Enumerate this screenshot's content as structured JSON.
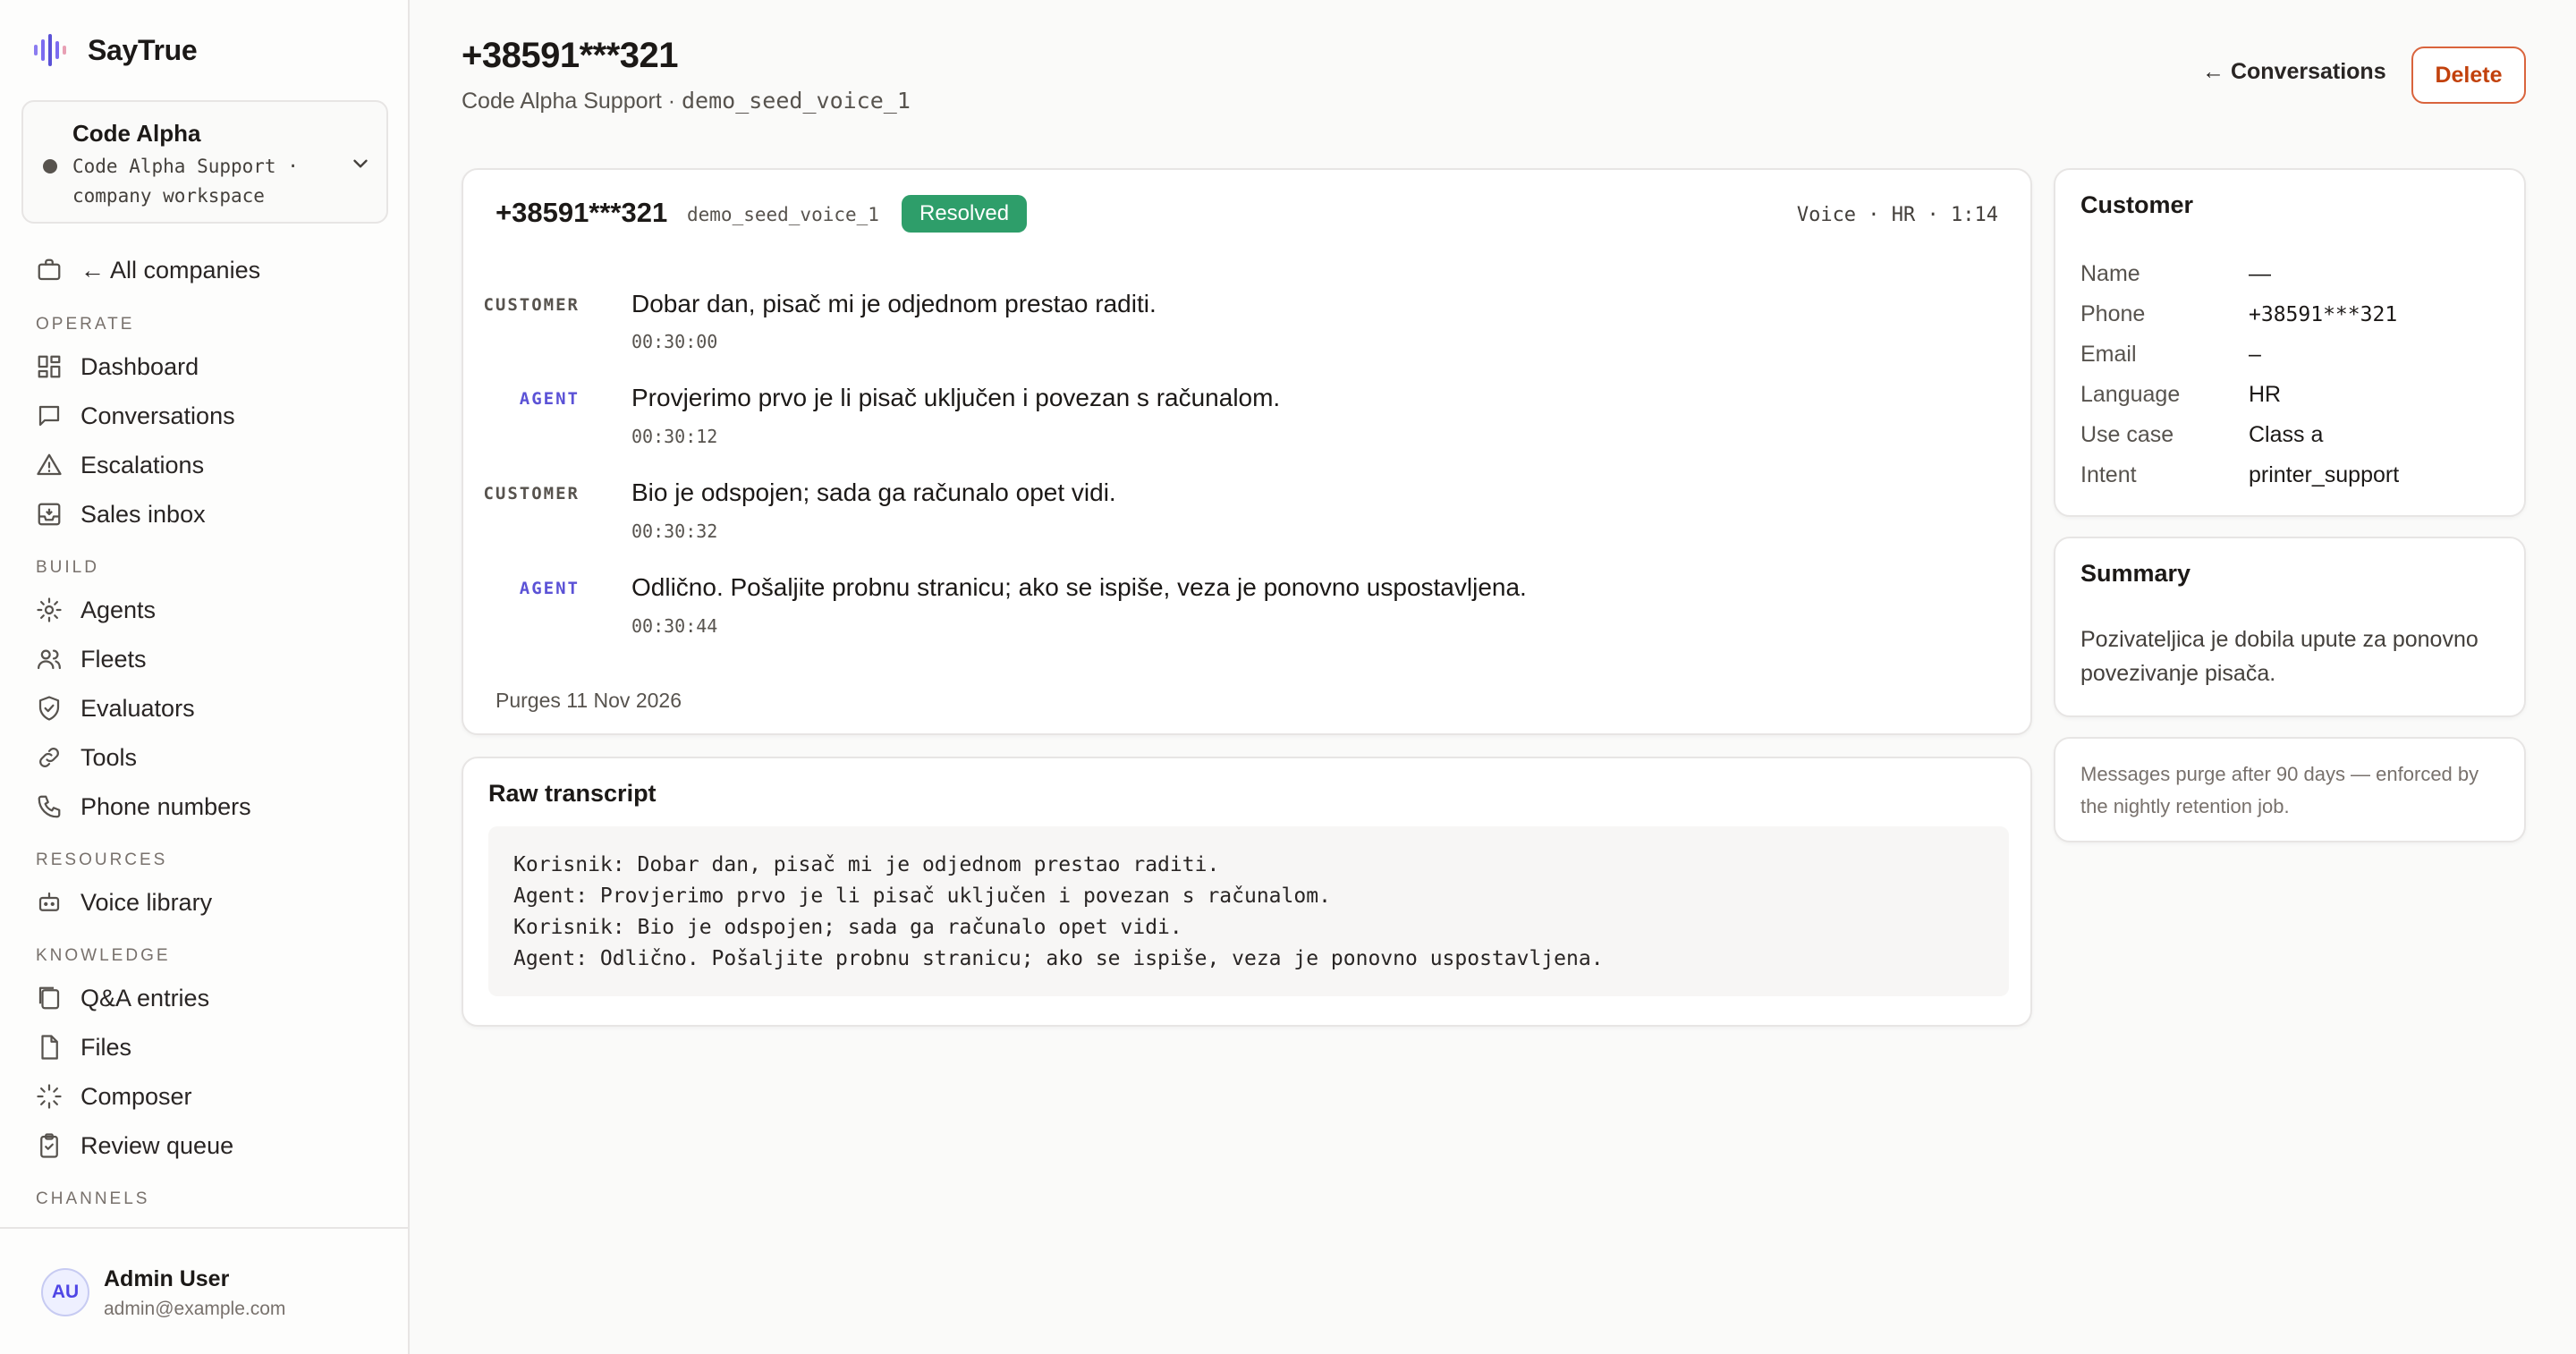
{
  "app": {
    "name": "SayTrue"
  },
  "workspace": {
    "name": "Code Alpha",
    "subtitle": "Code Alpha Support · company workspace"
  },
  "sidebar": {
    "all_companies": "← All companies",
    "sections": {
      "operate": "OPERATE",
      "build": "BUILD",
      "resources": "RESOURCES",
      "knowledge": "KNOWLEDGE",
      "channels": "CHANNELS"
    },
    "items": {
      "dashboard": "Dashboard",
      "conversations": "Conversations",
      "escalations": "Escalations",
      "sales_inbox": "Sales inbox",
      "agents": "Agents",
      "fleets": "Fleets",
      "evaluators": "Evaluators",
      "tools": "Tools",
      "phone_numbers": "Phone numbers",
      "voice_library": "Voice library",
      "qa_entries": "Q&A entries",
      "files": "Files",
      "composer": "Composer",
      "review_queue": "Review queue"
    }
  },
  "user": {
    "initials": "AU",
    "name": "Admin User",
    "email": "admin@example.com"
  },
  "header": {
    "title": "+38591***321",
    "subtitle_prefix": "Code Alpha Support · ",
    "subtitle_id": "demo_seed_voice_1",
    "back_label": "← Conversations",
    "delete_label": "Delete"
  },
  "conversation": {
    "number": "+38591***321",
    "id": "demo_seed_voice_1",
    "status": "Resolved",
    "meta": "Voice · HR · 1:14",
    "messages": [
      {
        "role": "CUSTOMER",
        "text": "Dobar dan, pisač mi je odjednom prestao raditi.",
        "time": "00:30:00"
      },
      {
        "role": "AGENT",
        "text": "Provjerimo prvo je li pisač uključen i povezan s računalom.",
        "time": "00:30:12"
      },
      {
        "role": "CUSTOMER",
        "text": "Bio je odspojen; sada ga računalo opet vidi.",
        "time": "00:30:32"
      },
      {
        "role": "AGENT",
        "text": "Odlično. Pošaljite probnu stranicu; ako se ispiše, veza je ponovno uspostavljena.",
        "time": "00:30:44"
      }
    ],
    "purges": "Purges 11 Nov 2026"
  },
  "raw_transcript": {
    "title": "Raw transcript",
    "lines": [
      "Korisnik: Dobar dan, pisač mi je odjednom prestao raditi.",
      "Agent: Provjerimo prvo je li pisač uključen i povezan s računalom.",
      "Korisnik: Bio je odspojen; sada ga računalo opet vidi.",
      "Agent: Odlično. Pošaljite probnu stranicu; ako se ispiše, veza je ponovno uspostavljena."
    ]
  },
  "customer": {
    "title": "Customer",
    "fields": [
      {
        "label": "Name",
        "value": "—"
      },
      {
        "label": "Phone",
        "value": "+38591***321"
      },
      {
        "label": "Email",
        "value": "–"
      },
      {
        "label": "Language",
        "value": "HR"
      },
      {
        "label": "Use case",
        "value": "Class a"
      },
      {
        "label": "Intent",
        "value": "printer_support"
      }
    ]
  },
  "summary": {
    "title": "Summary",
    "text": "Pozivateljica je dobila upute za ponovno povezivanje pisača."
  },
  "retention_note": "Messages purge after 90 days — enforced by the nightly retention job.",
  "colors": {
    "accent": "#5b52d6",
    "resolved": "#2e9e6a",
    "danger": "#c2410c"
  }
}
